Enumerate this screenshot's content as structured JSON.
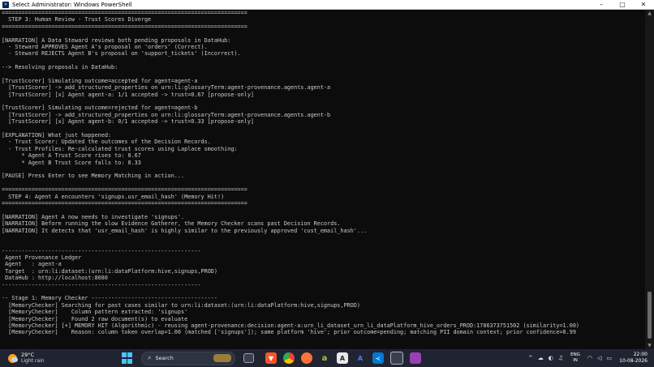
{
  "window": {
    "title": "Select Administrator: Windows PowerShell",
    "controls": [
      "–",
      "□",
      "✕"
    ]
  },
  "terminal": {
    "lines": [
      "==========================================================================",
      "  STEP 3: Human Review - Trust Scores Diverge",
      "==========================================================================",
      "",
      "[NARRATION] A Data Steward reviews both pending proposals in DataHub:",
      "  - Steward APPROVES Agent A's proposal on 'orders' (Correct).",
      "  - Steward REJECTS Agent B's proposal on 'support_tickets' (Incorrect).",
      "",
      "--> Resolving proposals in DataHub:",
      "",
      "[TrustScorer] Simulating outcome=accepted for agent=agent-a",
      "  [TrustScorer] -> add_structured_properties on urn:li:glossaryTerm:agent-provenance.agents.agent-a",
      "  [TrustScorer] [x] Agent agent-a: 1/1 accepted -> trust=0.67 [propose-only]",
      "",
      "[TrustScorer] Simulating outcome=rejected for agent=agent-b",
      "  [TrustScorer] -> add_structured_properties on urn:li:glossaryTerm:agent-provenance.agents.agent-b",
      "  [TrustScorer] [x] Agent agent-b: 0/1 accepted -> trust=0.33 [propose-only]",
      "",
      "[EXPLANATION] What just happened:",
      "  - Trust Scorer: Updated the outcomes of the Decision Records.",
      "  - Trust Profiles: Re-calculated trust scores using Laplace smoothing:",
      "      * Agent A Trust Score rises to: 0.67",
      "      * Agent B Trust Score falls to: 0.33",
      "",
      "[PAUSE] Press Enter to see Memory Matching in action...",
      "",
      "==========================================================================",
      "  STEP 4: Agent A encounters 'signups.usr_email_hash' (Memory Hit!)",
      "==========================================================================",
      "",
      "[NARRATION] Agent A now needs to investigate 'signups'.",
      "[NARRATION] Before running the slow Evidence Gatherer, the Memory Checker scans past Decision Records.",
      "[NARRATION] It detects that 'usr_email_hash' is highly similar to the previously approved 'cust_email_hash'...",
      "",
      "",
      "------------------------------------------------------------",
      " Agent Provenance Ledger",
      " Agent   : agent-a",
      " Target  : urn:li:dataset:(urn:li:dataPlatform:hive,signups,PROD)",
      " DataHub : http://localhost:8080",
      "------------------------------------------------------------",
      "",
      "-- Stage 1: Memory Checker --------------------------------------",
      "  [MemoryChecker] Searching for past cases similar to urn:li:dataset:(urn:li:dataPlatform:hive,signups,PROD)",
      "  [MemoryChecker]    Column pattern extracted: 'signups'",
      "  [MemoryChecker]    Found 2 raw document(s) to evaluate",
      "  [MemoryChecker] [+] MEMORY HIT (Algorithmic) - reusing agent-provenance:decision:agent-a:urn_li_dataset_urn_li_dataPlatform_hive_orders_PROD:1786373751502 (similarity=1.00)",
      "  [MemoryChecker]    Reason: column token overlap=1.00 (matched ['signups']); same platform 'hive'; prior outcome=pending; matching PII domain context; prior confidence=0.99"
    ]
  },
  "taskbar": {
    "weather": {
      "temp": "29°C",
      "desc": "Light rain"
    },
    "search_label": "Search",
    "lang_top": "ENG",
    "lang_bottom": "IN",
    "time": "22:00",
    "date": "10-08-2026",
    "icons": [
      "task-view-icon",
      "brave-icon",
      "chrome-icon",
      "firefox-icon",
      "android-studio-icon",
      "app-a-icon",
      "app-a2-icon",
      "vscode-icon",
      "visual-studio-icon",
      "app-pink-icon"
    ]
  }
}
